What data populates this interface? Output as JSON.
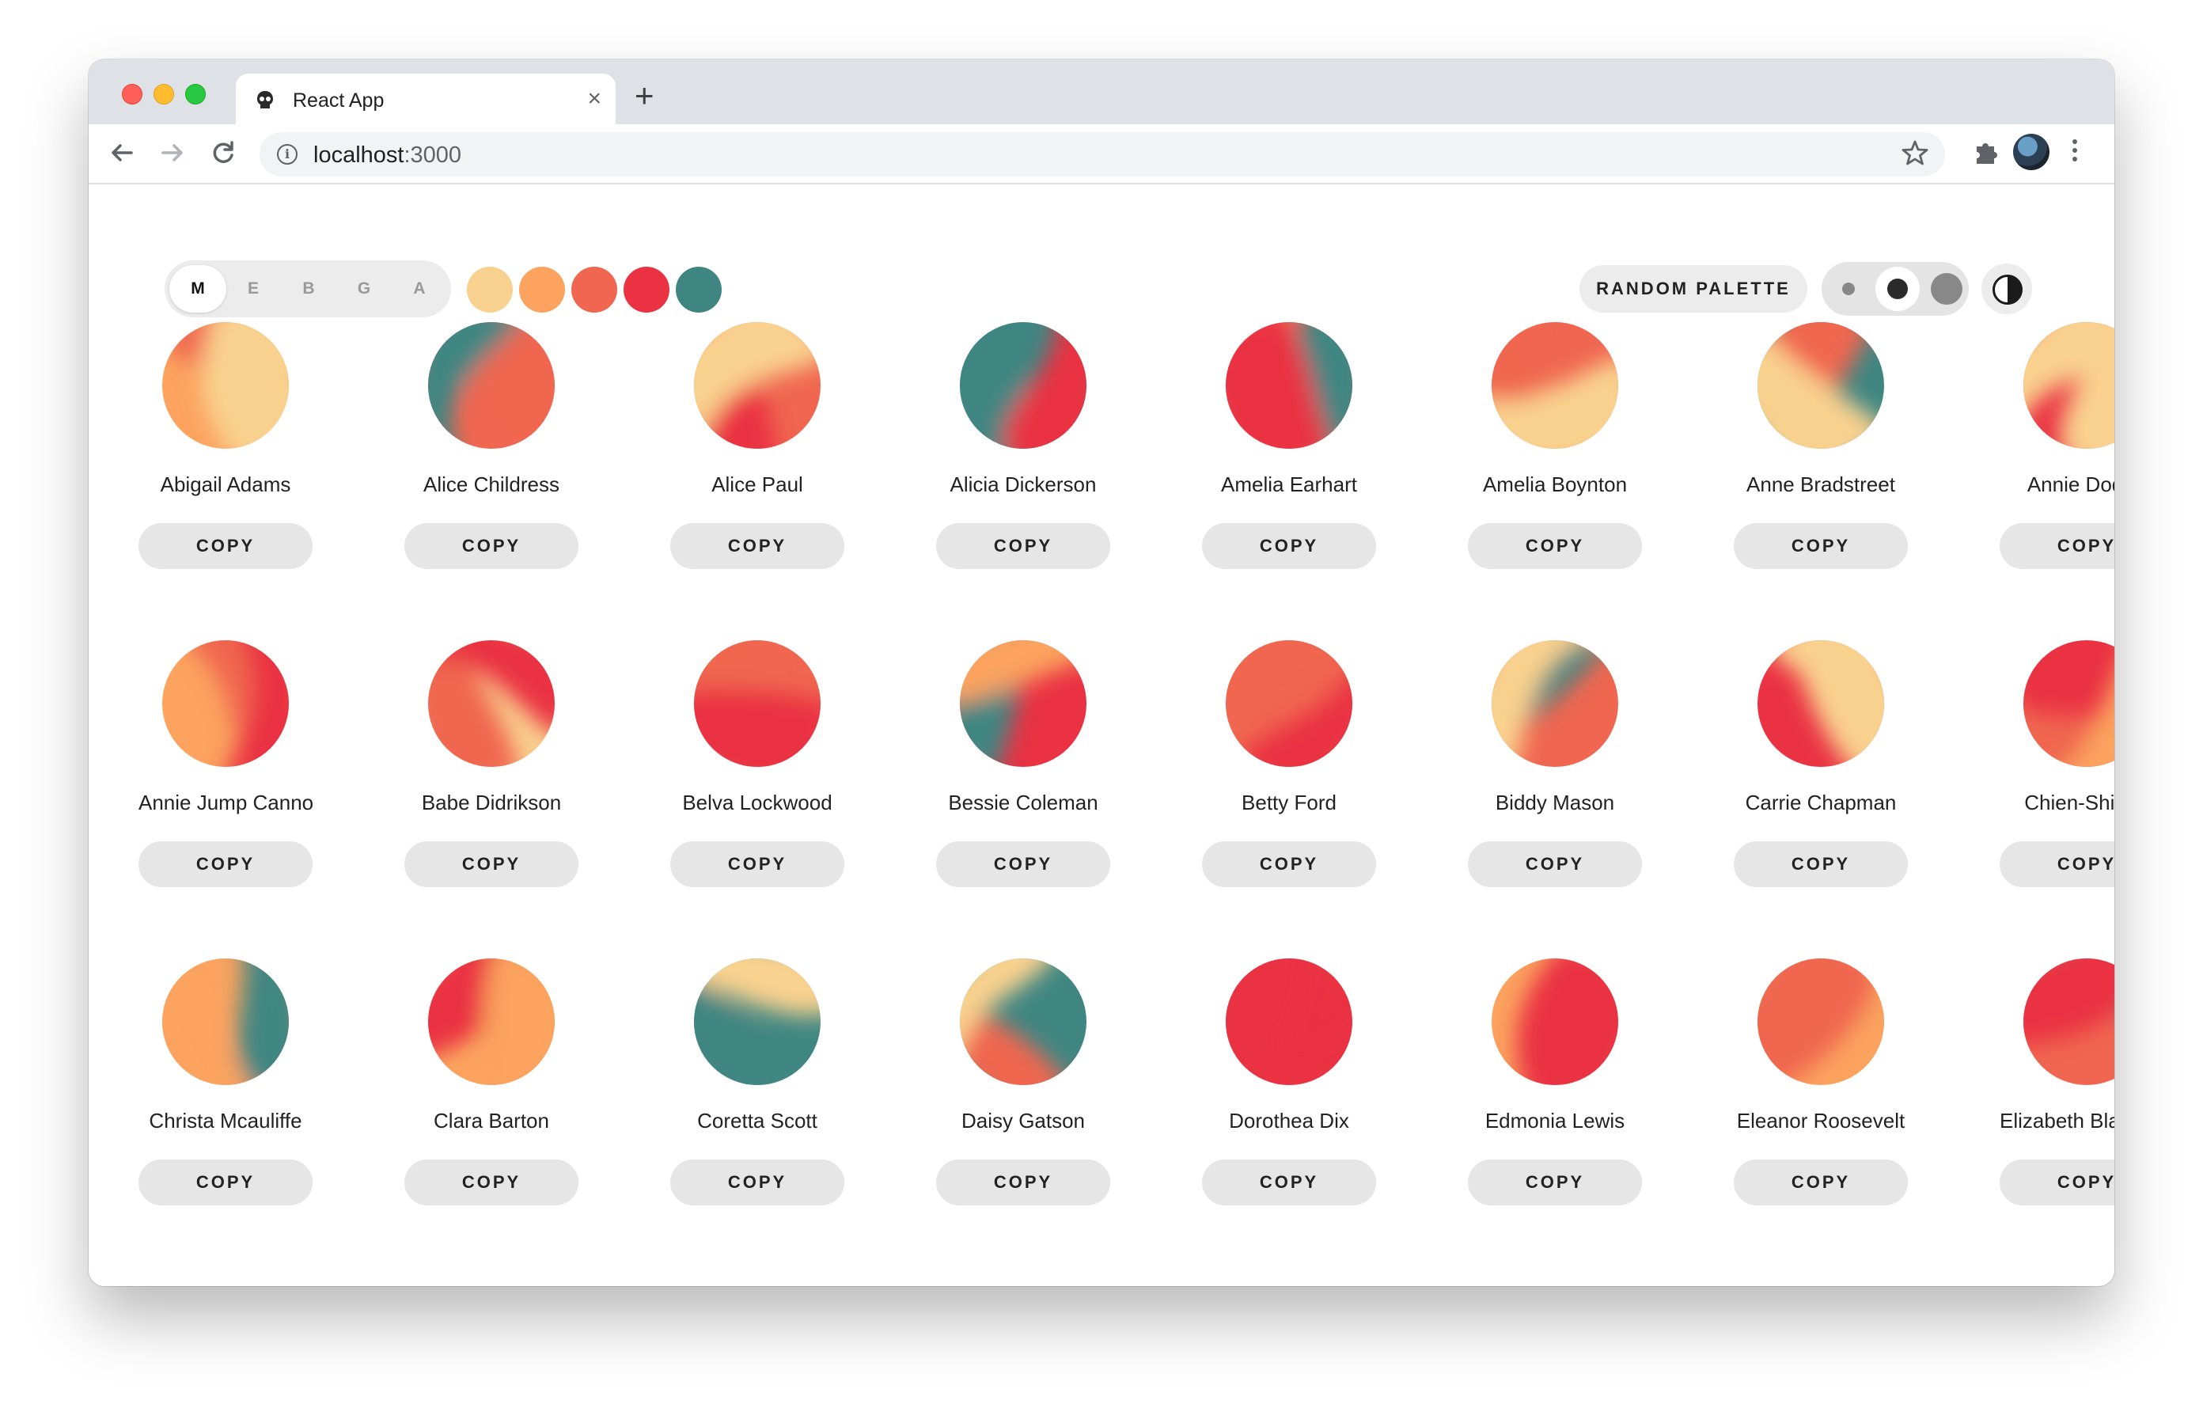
{
  "browser": {
    "tab_title": "React App",
    "tab_close": "×",
    "new_tab": "+",
    "url_host": "localhost",
    "url_port": ":3000"
  },
  "toolbar": {
    "variants": [
      {
        "label": "M",
        "active": true
      },
      {
        "label": "E",
        "active": false
      },
      {
        "label": "B",
        "active": false
      },
      {
        "label": "G",
        "active": false
      },
      {
        "label": "A",
        "active": false
      }
    ],
    "palette": [
      "#f9d18e",
      "#fba35f",
      "#f06650",
      "#ea3243",
      "#3f8682"
    ],
    "random_label": "RANDOM PALETTE",
    "size_options": [
      "small",
      "medium",
      "large"
    ],
    "size_active": 1
  },
  "avatars": [
    {
      "name": "Abigail Adams"
    },
    {
      "name": "Alice Childress"
    },
    {
      "name": "Alice Paul"
    },
    {
      "name": "Alicia Dickerson"
    },
    {
      "name": "Amelia Earhart"
    },
    {
      "name": "Amelia Boynton"
    },
    {
      "name": "Anne Bradstreet"
    },
    {
      "name": "Annie Dodge"
    },
    {
      "name": "Annie Jump Cannon"
    },
    {
      "name": "Babe Didrikson"
    },
    {
      "name": "Belva Lockwood"
    },
    {
      "name": "Bessie Coleman"
    },
    {
      "name": "Betty Ford"
    },
    {
      "name": "Biddy Mason"
    },
    {
      "name": "Carrie Chapman"
    },
    {
      "name": "Chien-Shiung"
    },
    {
      "name": "Christa Mcauliffe"
    },
    {
      "name": "Clara Barton"
    },
    {
      "name": "Coretta Scott"
    },
    {
      "name": "Daisy Gatson"
    },
    {
      "name": "Dorothea Dix"
    },
    {
      "name": "Edmonia Lewis"
    },
    {
      "name": "Eleanor Roosevelt"
    },
    {
      "name": "Elizabeth Blackwell"
    }
  ],
  "copy_label": "COPY"
}
